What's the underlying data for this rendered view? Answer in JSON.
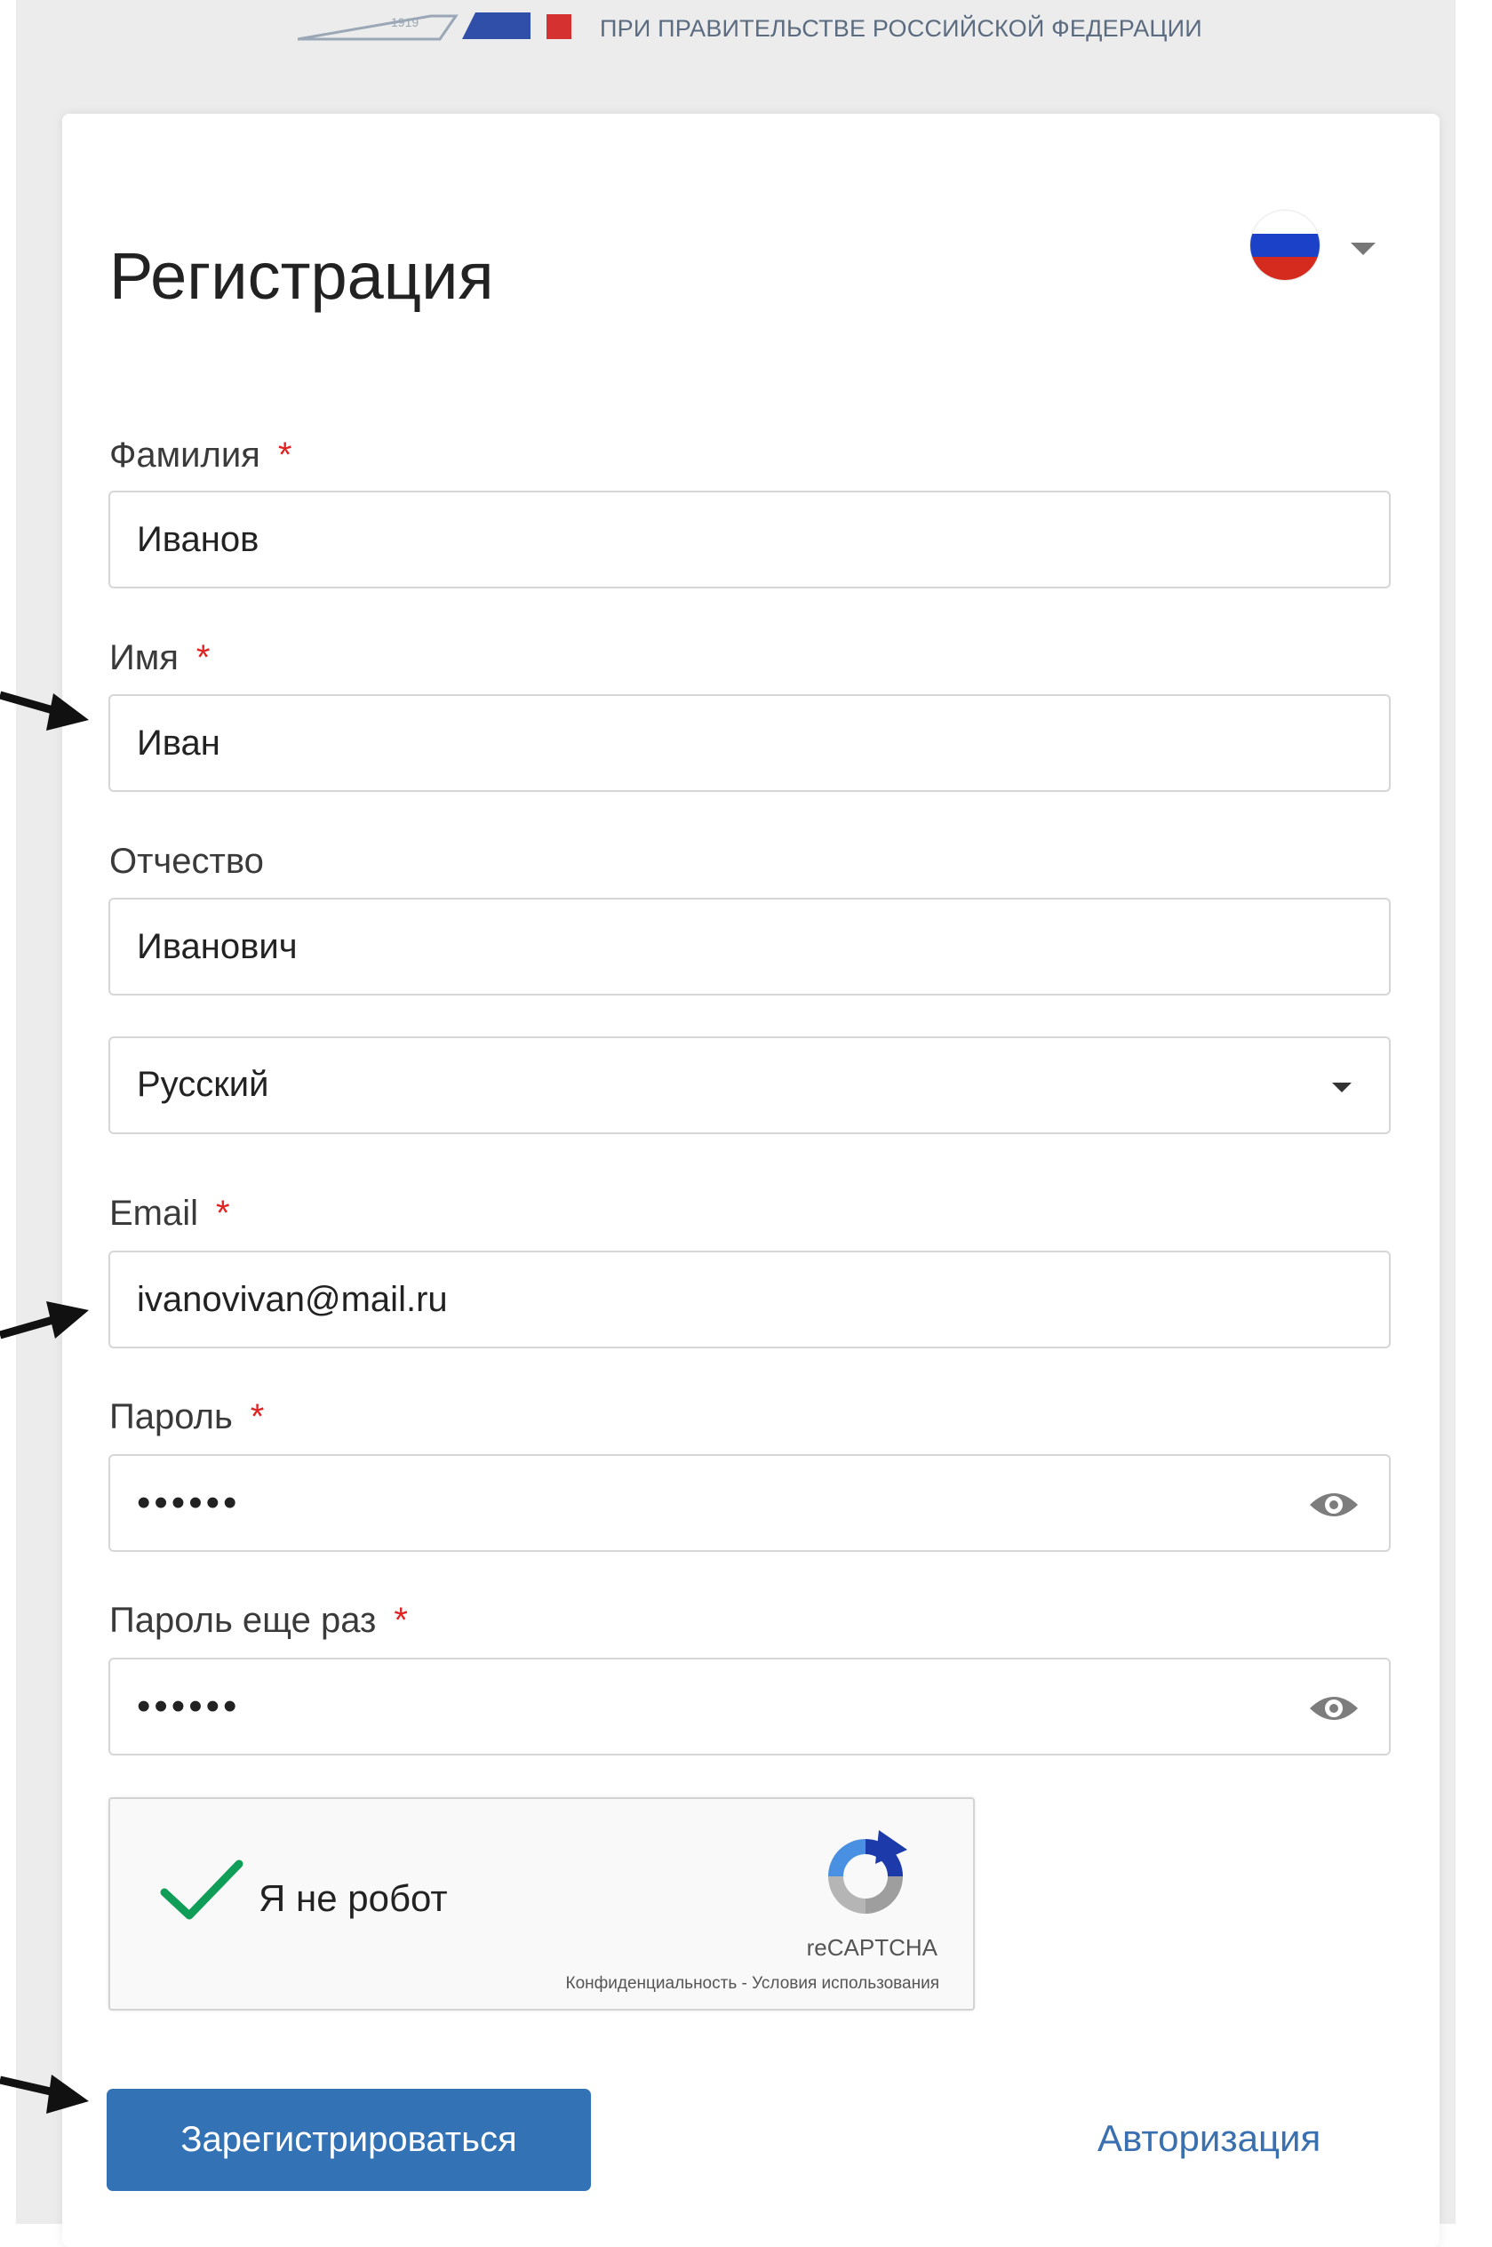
{
  "header": {
    "org_subtitle": "При Правительстве Российской Федерации",
    "logo_year": "1919"
  },
  "form": {
    "title": "Регистрация",
    "language_flag": "ru-flag",
    "required_mark": "*",
    "fields": {
      "last_name": {
        "label": "Фамилия",
        "value": "Иванов",
        "required": true
      },
      "first_name": {
        "label": "Имя",
        "value": "Иван",
        "required": true
      },
      "middle_name": {
        "label": "Отчество",
        "value": "Иванович",
        "required": false
      },
      "language_select": {
        "value": "Русский"
      },
      "email": {
        "label": "Email",
        "value": "ivanovivan@mail.ru",
        "required": true
      },
      "password": {
        "label": "Пароль",
        "value": "••••••",
        "required": true
      },
      "password_repeat": {
        "label": "Пароль еще раз",
        "value": "••••••",
        "required": true
      }
    },
    "captcha": {
      "label": "Я не робот",
      "brand": "reCAPTCHA",
      "links": "Конфиденциальность - Условия использования",
      "checked": true
    },
    "submit_label": "Зарегистрироваться",
    "login_link": "Авторизация"
  },
  "colors": {
    "primary_button": "#3372b5",
    "link": "#3a6fb0",
    "required": "#e02424",
    "check": "#0f9d58"
  }
}
